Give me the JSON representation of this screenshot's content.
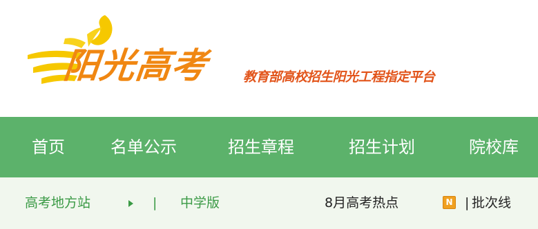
{
  "brand": {
    "logo_icon": "sun-rays-logo-icon",
    "title": "阳光高考",
    "slogan": "教育部高校招生阳光工程指定平台",
    "colors": {
      "title": "#f08712",
      "slogan": "#e2541a",
      "sun": "#f6c800"
    }
  },
  "nav": {
    "background": "#5cb26b",
    "items": [
      {
        "label": "首页"
      },
      {
        "label": "名单公示"
      },
      {
        "label": "招生章程"
      },
      {
        "label": "招生计划"
      },
      {
        "label": "院校库"
      }
    ]
  },
  "subbar": {
    "local_sites": "高考地方站",
    "local_sites_arrow_icon": "caret-right-icon",
    "separator": "|",
    "middle_school": "中学版",
    "hot_topics": "8月高考热点",
    "hot_badge": {
      "icon": "news-badge-icon",
      "letter": "N"
    },
    "divider": "|",
    "link": "批次线"
  }
}
